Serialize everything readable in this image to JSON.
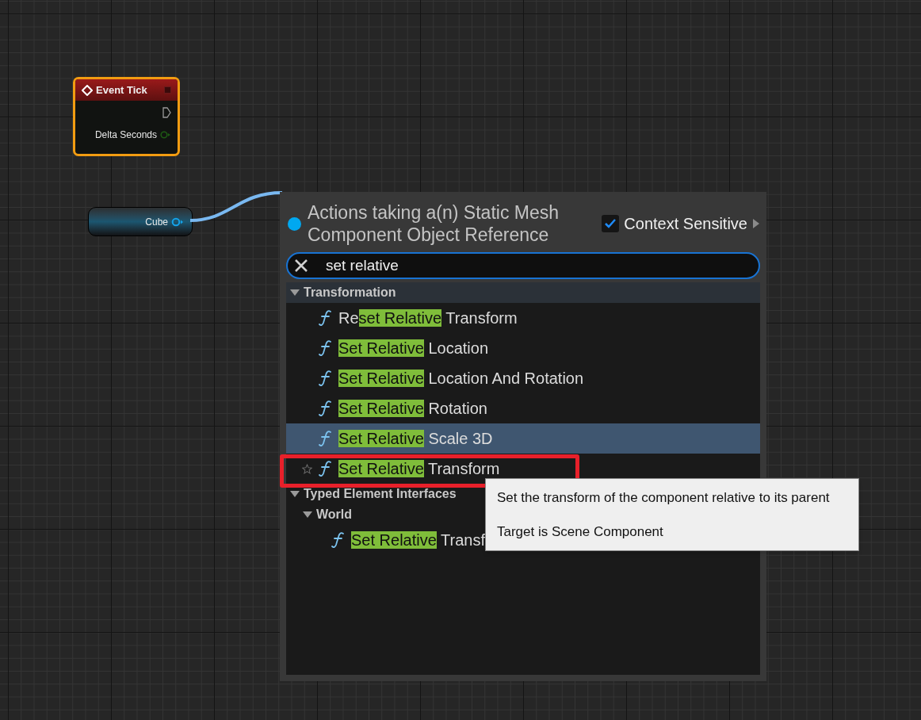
{
  "nodes": [
    {
      "kind": "event",
      "title": "Event Tick",
      "pins": [
        {
          "kind": "exec"
        },
        {
          "kind": "float",
          "label": "Delta Seconds"
        }
      ],
      "selected": true
    },
    {
      "kind": "variable",
      "title": "Cube"
    }
  ],
  "action_menu": {
    "title": "Actions taking a(n) Static Mesh Component Object Reference",
    "context_sensitive": {
      "label": "Context Sensitive",
      "checked": true
    },
    "search": {
      "value": "set relative"
    },
    "tree": [
      {
        "kind": "category",
        "label": "Transformation",
        "expanded": true,
        "children": [
          {
            "kind": "action",
            "prefix": "Re",
            "match": "set Relative",
            "suffix": " Transform",
            "selected": false,
            "hovered": false,
            "outlined": false
          },
          {
            "kind": "action",
            "match": "Set Relative",
            "suffix": " Location",
            "selected": false,
            "hovered": false,
            "outlined": false
          },
          {
            "kind": "action",
            "match": "Set Relative",
            "suffix": " Location And Rotation",
            "selected": false,
            "hovered": false,
            "outlined": false
          },
          {
            "kind": "action",
            "match": "Set Relative",
            "suffix": " Rotation",
            "selected": false,
            "hovered": false,
            "outlined": false
          },
          {
            "kind": "action",
            "match": "Set Relative",
            "suffix": " Scale 3D",
            "selected": true,
            "hovered": false,
            "outlined": false
          },
          {
            "kind": "action",
            "match": "Set Relative",
            "suffix": " Transform",
            "selected": false,
            "hovered": true,
            "outlined": true
          }
        ]
      },
      {
        "kind": "category",
        "label": "Typed Element Interfaces",
        "expanded": true,
        "children": [
          {
            "kind": "category",
            "label": "World",
            "expanded": true,
            "children": [
              {
                "kind": "action",
                "match": "Set Relative",
                "suffix": " Transf",
                "selected": false,
                "hovered": false,
                "outlined": false
              }
            ]
          }
        ]
      }
    ],
    "tooltip": {
      "lines": [
        "Set the transform of the component relative to its parent",
        "Target is Scene Component"
      ]
    }
  }
}
